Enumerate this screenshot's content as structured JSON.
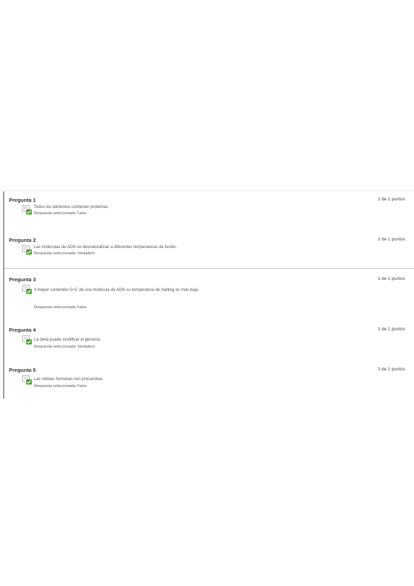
{
  "questions": [
    {
      "title": "Pregunta 1",
      "points": "1 de 1 puntos",
      "text": "Todos los alimentos contienen proteínas.",
      "answer_prefix": "Respuesta seleccionada:",
      "answer": "Falso"
    },
    {
      "title": "Pregunta 2",
      "points": "1 de 1 puntos",
      "text": "Las moléculas de ADN se desnaturalizan a diferentes temperaturas de fusión.",
      "answer_prefix": "Respuesta seleccionada:",
      "answer": "Verdadero"
    },
    {
      "title": "Pregunta 3",
      "points": "1 de 1 puntos",
      "text": "A mayor contenido G+C de una molécula de ADN su temperatura de melting es más baja.",
      "answer_prefix": "Respuesta seleccionada:",
      "answer": "Falso"
    },
    {
      "title": "Pregunta 4",
      "points": "1 de 1 puntos",
      "text": "La dieta puede modificar el genoma.",
      "answer_prefix": "Respuesta seleccionada:",
      "answer": "Verdadero"
    },
    {
      "title": "Pregunta 5",
      "points": "1 de 1 puntos",
      "text": "Las células humanas son procariotas.",
      "answer_prefix": "Respuesta seleccionada:",
      "answer": "Falso"
    }
  ],
  "colors": {
    "correct_check": "#4aa02c",
    "divider": "#c8c8c8"
  },
  "icons": {
    "correct": "correct-answer-icon"
  }
}
